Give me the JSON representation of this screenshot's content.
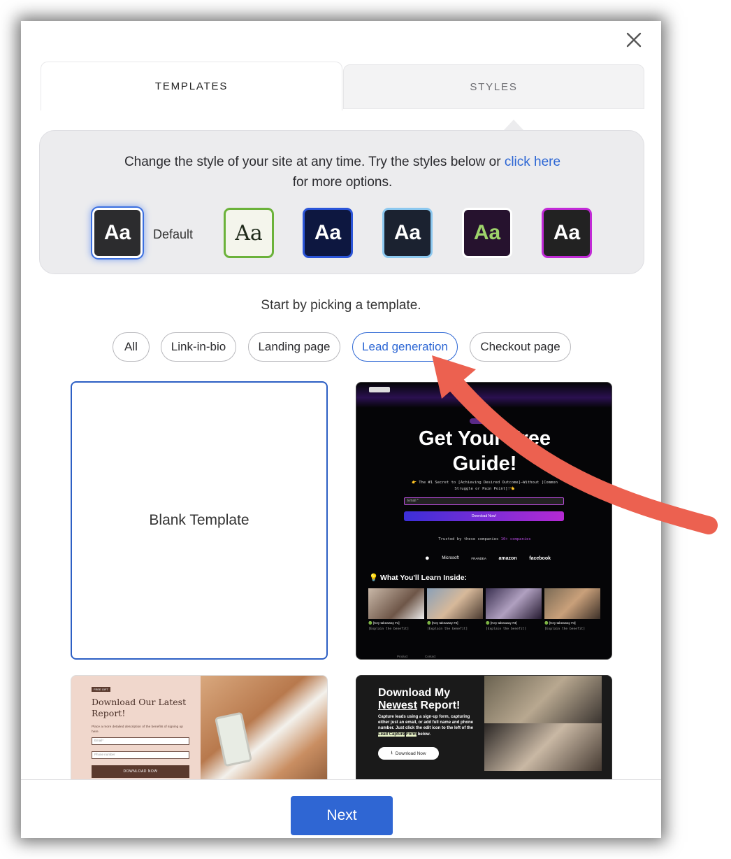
{
  "tabs": {
    "templates": "TEMPLATES",
    "styles": "STYLES"
  },
  "styles_panel": {
    "text_before": "Change the style of your site at any time. Try the styles below or ",
    "link": "click here",
    "text_after": "for more options.",
    "swatch_text": "Aa",
    "default_label": "Default"
  },
  "pick_prompt": "Start by picking a template.",
  "filters": [
    "All",
    "Link-in-bio",
    "Landing page",
    "Lead generation",
    "Checkout page"
  ],
  "blank_card": "Blank Template",
  "guide_card": {
    "title_line1": "Get Your Free",
    "title_line2": "Guide!",
    "subtitle": "👉 The #1 Secret to [Achieving Desired Outcome]—Without [Common Struggle or Pain Point]!👈",
    "email_placeholder": "Email *",
    "button": "Download Now!",
    "trusted": "Trusted by these companies",
    "trusted_count": "10+ companies",
    "logos": [
      "Microsoft",
      "FRANDEA",
      "amazon",
      "facebook"
    ],
    "section_title": "💡 What You'll Learn Inside:",
    "items": [
      {
        "title": "🟢 [Key takeaway #1]",
        "sub": "[Explain the benefit]"
      },
      {
        "title": "🟢 [Key takeaway #2]",
        "sub": "[Explain the benefit]"
      },
      {
        "title": "🟢 [Key takeaway #3]",
        "sub": "[Explain the benefit]"
      },
      {
        "title": "🟢 [Key takeaway #4]",
        "sub": "[Explain the benefit]"
      }
    ],
    "footer_links": [
      "Product",
      "Contact"
    ]
  },
  "report_card": {
    "badge": "FREE GIFT",
    "title": "Download Our Latest Report!",
    "description": "Place a more detailed description of the benefits of signing up here.",
    "email_placeholder": "Email*",
    "phone_placeholder": "Phone number",
    "button": "DOWNLOAD NOW"
  },
  "newest_card": {
    "title_line1": "Download My",
    "title_newest": "Newest",
    "title_rest": " Report!",
    "description": "Capture leads using a sign-up form, capturing either just an email, or add full name and phone number. Just click the edit icon to the left of the",
    "highlight1": "Lead Capture",
    "highlight2": "Form",
    "desc_end": "below.",
    "button": "Download Now"
  },
  "next_button": "Next",
  "colors": {
    "accent": "#2f66d3",
    "arrow": "#ec6150"
  }
}
